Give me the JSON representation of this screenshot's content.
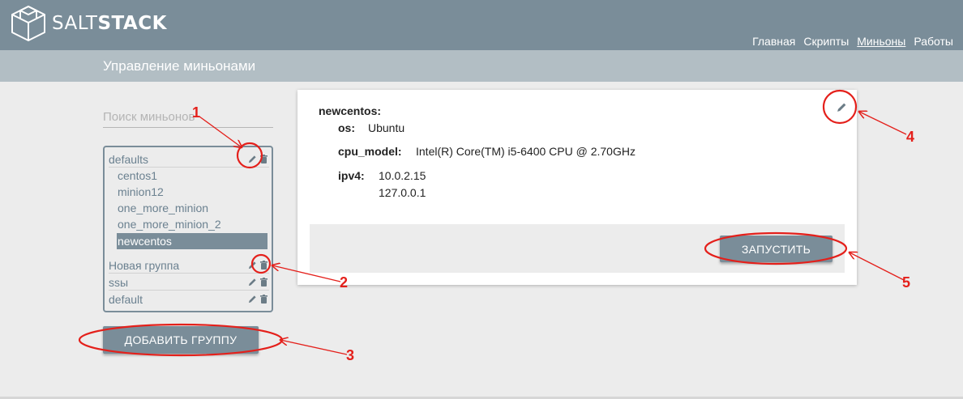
{
  "app": {
    "logo_light": "SALT",
    "logo_bold": "STACK"
  },
  "nav": [
    {
      "label": "Главная",
      "active": false
    },
    {
      "label": "Скрипты",
      "active": false
    },
    {
      "label": "Миньоны",
      "active": true
    },
    {
      "label": "Работы",
      "active": false
    }
  ],
  "page_title": "Управление миньонами",
  "search": {
    "placeholder": "Поиск миньонов",
    "value": ""
  },
  "groups": [
    {
      "name": "defaults",
      "minions": [
        "centos1",
        "minion12",
        "one_more_minion",
        "one_more_minion_2",
        "newcentos"
      ],
      "selected": "newcentos"
    },
    {
      "name": "Новая группа",
      "minions": []
    },
    {
      "name": "ssы",
      "minions": []
    },
    {
      "name": "default",
      "minions": []
    }
  ],
  "add_group_label": "ДОБАВИТЬ ГРУППУ",
  "details": {
    "minion": "newcentos:",
    "os_key": "os:",
    "os_val": "Ubuntu",
    "cpu_key": "cpu_model:",
    "cpu_val": "Intel(R) Core(TM) i5-6400 CPU @ 2.70GHz",
    "ipv4_key": "ipv4:",
    "ipv4_vals": [
      "10.0.2.15",
      "127.0.0.1"
    ]
  },
  "run_label": "ЗАПУСТИТЬ",
  "annotations": [
    "1",
    "2",
    "3",
    "4",
    "5"
  ],
  "colors": {
    "accent": "#7a8d99",
    "annotation": "#e4201b"
  }
}
